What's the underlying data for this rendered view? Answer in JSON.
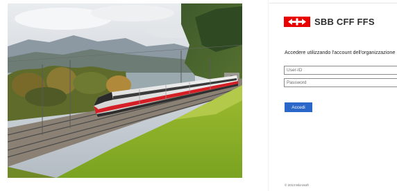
{
  "brand": {
    "logo_text": "SBB CFF FFS",
    "logo_color": "#eb0000"
  },
  "hero": {
    "image_icon": "train-photo"
  },
  "login": {
    "heading": "Accedere utilizzando l'account dell'organizzazione",
    "userid_placeholder": "User-ID",
    "password_placeholder": "Password",
    "submit_label": "Accedi",
    "button_color": "#2b66c9"
  },
  "footer": {
    "copyright": "© 2013 Microsoft"
  }
}
